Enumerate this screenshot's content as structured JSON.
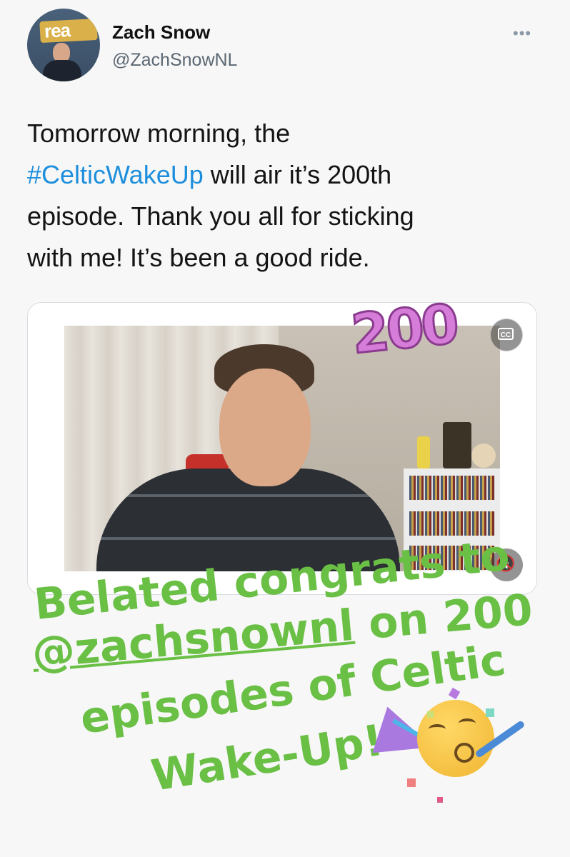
{
  "tweet": {
    "display_name": "Zach Snow",
    "handle": "@ZachSnowNL",
    "more_icon": "•••",
    "text_line1": "Tomorrow morning, the",
    "hashtag": "#CelticWakeUp",
    "text_line2_rest": " will air it’s 200th",
    "text_line3": "episode. Thank you all for sticking",
    "text_line4": "with me! It’s been a good ride."
  },
  "media": {
    "overlay_text": "200",
    "cc_label": "CC",
    "mute_icon": "speaker-muted-icon"
  },
  "sticker": {
    "line1": "Belated congrats to",
    "line2_mention": "@zachsnownl",
    "line2_rest": " on 200",
    "line3": "episodes of Celtic",
    "line4": "Wake-Up!",
    "color": "#6abf45",
    "emoji": "partying-face-icon"
  }
}
